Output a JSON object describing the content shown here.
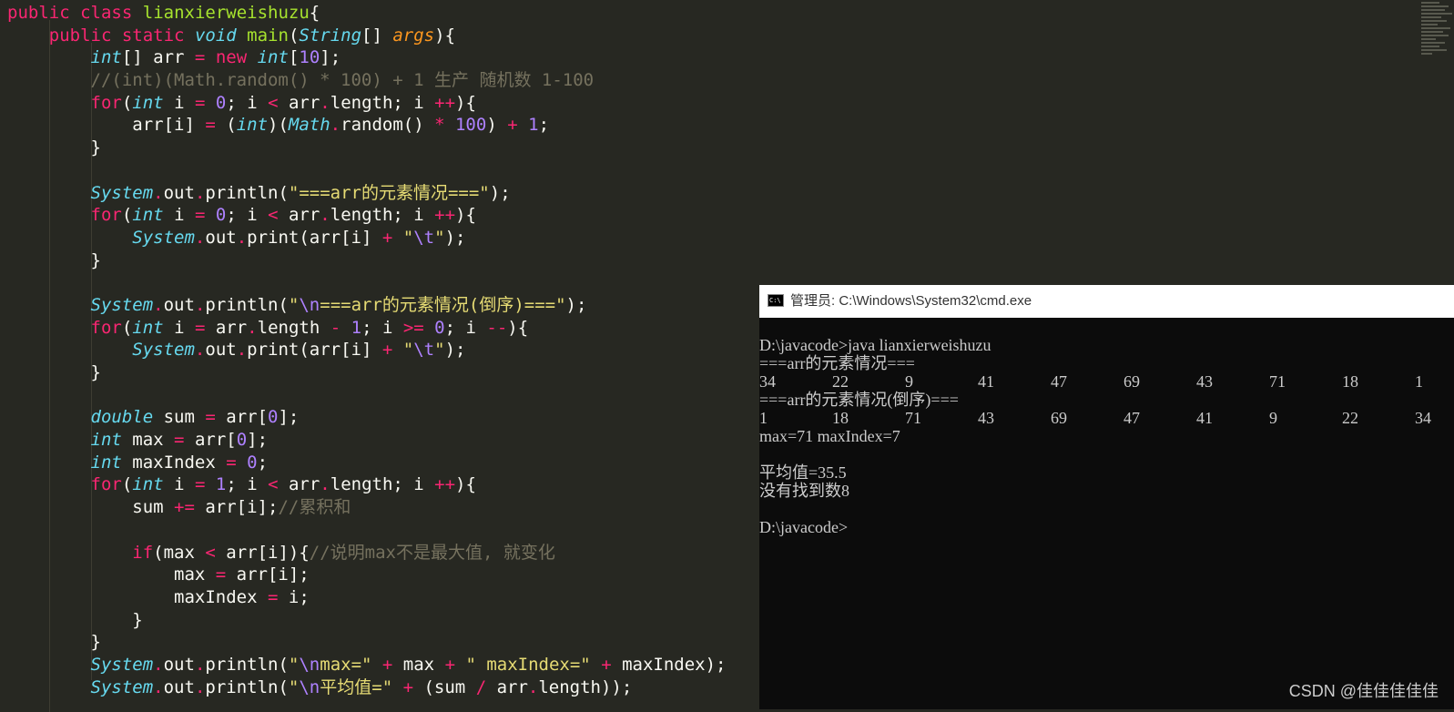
{
  "colors": {
    "editor_background": "#272822",
    "keyword": "#f92672",
    "type": "#66d9ef",
    "function": "#a6e22e",
    "string": "#e6db74",
    "number": "#ae81ff",
    "comment": "#75715e",
    "parameter": "#fd971f",
    "text": "#f8f8f2",
    "console_background": "#0c0c0c",
    "console_text": "#cccccc"
  },
  "editor": {
    "lines": [
      [
        [
          "kw",
          "public"
        ],
        [
          "tx",
          " "
        ],
        [
          "kw",
          "class"
        ],
        [
          "tx",
          " "
        ],
        [
          "fn",
          "lianxierweishuzu"
        ],
        [
          "tx",
          "{"
        ]
      ],
      [
        [
          "tx",
          "    "
        ],
        [
          "kw",
          "public"
        ],
        [
          "tx",
          " "
        ],
        [
          "kw",
          "static"
        ],
        [
          "tx",
          " "
        ],
        [
          "ty",
          "void"
        ],
        [
          "tx",
          " "
        ],
        [
          "fn",
          "main"
        ],
        [
          "tx",
          "("
        ],
        [
          "ty",
          "String"
        ],
        [
          "tx",
          "[] "
        ],
        [
          "pm",
          "args"
        ],
        [
          "tx",
          "){"
        ]
      ],
      [
        [
          "tx",
          "        "
        ],
        [
          "ty",
          "int"
        ],
        [
          "tx",
          "[] arr "
        ],
        [
          "kw",
          "="
        ],
        [
          "tx",
          " "
        ],
        [
          "kw",
          "new"
        ],
        [
          "tx",
          " "
        ],
        [
          "ty",
          "int"
        ],
        [
          "tx",
          "["
        ],
        [
          "nm",
          "10"
        ],
        [
          "tx",
          "];"
        ]
      ],
      [
        [
          "tx",
          "        "
        ],
        [
          "cm",
          "//(int)(Math.random() * 100) + 1 生产 随机数 1-100"
        ]
      ],
      [
        [
          "tx",
          "        "
        ],
        [
          "kw",
          "for"
        ],
        [
          "tx",
          "("
        ],
        [
          "ty",
          "int"
        ],
        [
          "tx",
          " i "
        ],
        [
          "kw",
          "="
        ],
        [
          "tx",
          " "
        ],
        [
          "nm",
          "0"
        ],
        [
          "tx",
          "; i "
        ],
        [
          "kw",
          "<"
        ],
        [
          "tx",
          " arr"
        ],
        [
          "kw",
          "."
        ],
        [
          "tx",
          "length; i "
        ],
        [
          "kw",
          "++"
        ],
        [
          "tx",
          "){"
        ]
      ],
      [
        [
          "tx",
          "            arr[i] "
        ],
        [
          "kw",
          "="
        ],
        [
          "tx",
          " ("
        ],
        [
          "ty",
          "int"
        ],
        [
          "tx",
          ")("
        ],
        [
          "ty",
          "Math"
        ],
        [
          "kw",
          "."
        ],
        [
          "tx",
          "random() "
        ],
        [
          "kw",
          "*"
        ],
        [
          "tx",
          " "
        ],
        [
          "nm",
          "100"
        ],
        [
          "tx",
          ") "
        ],
        [
          "kw",
          "+"
        ],
        [
          "tx",
          " "
        ],
        [
          "nm",
          "1"
        ],
        [
          "tx",
          ";"
        ]
      ],
      [
        [
          "tx",
          "        }"
        ]
      ],
      [
        [
          "tx",
          ""
        ]
      ],
      [
        [
          "tx",
          "        "
        ],
        [
          "ty",
          "System"
        ],
        [
          "kw",
          "."
        ],
        [
          "tx",
          "out"
        ],
        [
          "kw",
          "."
        ],
        [
          "tx",
          "println("
        ],
        [
          "st",
          "\"===arr的元素情况===\""
        ],
        [
          "tx",
          ");"
        ]
      ],
      [
        [
          "tx",
          "        "
        ],
        [
          "kw",
          "for"
        ],
        [
          "tx",
          "("
        ],
        [
          "ty",
          "int"
        ],
        [
          "tx",
          " i "
        ],
        [
          "kw",
          "="
        ],
        [
          "tx",
          " "
        ],
        [
          "nm",
          "0"
        ],
        [
          "tx",
          "; i "
        ],
        [
          "kw",
          "<"
        ],
        [
          "tx",
          " arr"
        ],
        [
          "kw",
          "."
        ],
        [
          "tx",
          "length; i "
        ],
        [
          "kw",
          "++"
        ],
        [
          "tx",
          "){"
        ]
      ],
      [
        [
          "tx",
          "            "
        ],
        [
          "ty",
          "System"
        ],
        [
          "kw",
          "."
        ],
        [
          "tx",
          "out"
        ],
        [
          "kw",
          "."
        ],
        [
          "tx",
          "print(arr[i] "
        ],
        [
          "kw",
          "+"
        ],
        [
          "tx",
          " "
        ],
        [
          "st",
          "\""
        ],
        [
          "nm",
          "\\t"
        ],
        [
          "st",
          "\""
        ],
        [
          "tx",
          ");"
        ]
      ],
      [
        [
          "tx",
          "        }"
        ]
      ],
      [
        [
          "tx",
          ""
        ]
      ],
      [
        [
          "tx",
          "        "
        ],
        [
          "ty",
          "System"
        ],
        [
          "kw",
          "."
        ],
        [
          "tx",
          "out"
        ],
        [
          "kw",
          "."
        ],
        [
          "tx",
          "println("
        ],
        [
          "st",
          "\""
        ],
        [
          "nm",
          "\\n"
        ],
        [
          "st",
          "===arr的元素情况(倒序)===\""
        ],
        [
          "tx",
          ");"
        ]
      ],
      [
        [
          "tx",
          "        "
        ],
        [
          "kw",
          "for"
        ],
        [
          "tx",
          "("
        ],
        [
          "ty",
          "int"
        ],
        [
          "tx",
          " i "
        ],
        [
          "kw",
          "="
        ],
        [
          "tx",
          " arr"
        ],
        [
          "kw",
          "."
        ],
        [
          "tx",
          "length "
        ],
        [
          "kw",
          "-"
        ],
        [
          "tx",
          " "
        ],
        [
          "nm",
          "1"
        ],
        [
          "tx",
          "; i "
        ],
        [
          "kw",
          ">="
        ],
        [
          "tx",
          " "
        ],
        [
          "nm",
          "0"
        ],
        [
          "tx",
          "; i "
        ],
        [
          "kw",
          "--"
        ],
        [
          "tx",
          "){"
        ]
      ],
      [
        [
          "tx",
          "            "
        ],
        [
          "ty",
          "System"
        ],
        [
          "kw",
          "."
        ],
        [
          "tx",
          "out"
        ],
        [
          "kw",
          "."
        ],
        [
          "tx",
          "print(arr[i] "
        ],
        [
          "kw",
          "+"
        ],
        [
          "tx",
          " "
        ],
        [
          "st",
          "\""
        ],
        [
          "nm",
          "\\t"
        ],
        [
          "st",
          "\""
        ],
        [
          "tx",
          ");"
        ]
      ],
      [
        [
          "tx",
          "        }"
        ]
      ],
      [
        [
          "tx",
          ""
        ]
      ],
      [
        [
          "tx",
          "        "
        ],
        [
          "ty",
          "double"
        ],
        [
          "tx",
          " sum "
        ],
        [
          "kw",
          "="
        ],
        [
          "tx",
          " arr["
        ],
        [
          "nm",
          "0"
        ],
        [
          "tx",
          "];"
        ]
      ],
      [
        [
          "tx",
          "        "
        ],
        [
          "ty",
          "int"
        ],
        [
          "tx",
          " max "
        ],
        [
          "kw",
          "="
        ],
        [
          "tx",
          " arr["
        ],
        [
          "nm",
          "0"
        ],
        [
          "tx",
          "];"
        ]
      ],
      [
        [
          "tx",
          "        "
        ],
        [
          "ty",
          "int"
        ],
        [
          "tx",
          " maxIndex "
        ],
        [
          "kw",
          "="
        ],
        [
          "tx",
          " "
        ],
        [
          "nm",
          "0"
        ],
        [
          "tx",
          ";"
        ]
      ],
      [
        [
          "tx",
          "        "
        ],
        [
          "kw",
          "for"
        ],
        [
          "tx",
          "("
        ],
        [
          "ty",
          "int"
        ],
        [
          "tx",
          " i "
        ],
        [
          "kw",
          "="
        ],
        [
          "tx",
          " "
        ],
        [
          "nm",
          "1"
        ],
        [
          "tx",
          "; i "
        ],
        [
          "kw",
          "<"
        ],
        [
          "tx",
          " arr"
        ],
        [
          "kw",
          "."
        ],
        [
          "tx",
          "length; i "
        ],
        [
          "kw",
          "++"
        ],
        [
          "tx",
          "){"
        ]
      ],
      [
        [
          "tx",
          "            sum "
        ],
        [
          "kw",
          "+="
        ],
        [
          "tx",
          " arr[i];"
        ],
        [
          "cm",
          "//累积和"
        ]
      ],
      [
        [
          "tx",
          ""
        ]
      ],
      [
        [
          "tx",
          "            "
        ],
        [
          "kw",
          "if"
        ],
        [
          "tx",
          "(max "
        ],
        [
          "kw",
          "<"
        ],
        [
          "tx",
          " arr[i]){"
        ],
        [
          "cm",
          "//说明max不是最大值, 就变化"
        ]
      ],
      [
        [
          "tx",
          "                max "
        ],
        [
          "kw",
          "="
        ],
        [
          "tx",
          " arr[i];"
        ]
      ],
      [
        [
          "tx",
          "                maxIndex "
        ],
        [
          "kw",
          "="
        ],
        [
          "tx",
          " i;"
        ]
      ],
      [
        [
          "tx",
          "            }"
        ]
      ],
      [
        [
          "tx",
          "        }"
        ]
      ],
      [
        [
          "tx",
          "        "
        ],
        [
          "ty",
          "System"
        ],
        [
          "kw",
          "."
        ],
        [
          "tx",
          "out"
        ],
        [
          "kw",
          "."
        ],
        [
          "tx",
          "println("
        ],
        [
          "st",
          "\""
        ],
        [
          "nm",
          "\\n"
        ],
        [
          "st",
          "max=\""
        ],
        [
          "tx",
          " "
        ],
        [
          "kw",
          "+"
        ],
        [
          "tx",
          " max "
        ],
        [
          "kw",
          "+"
        ],
        [
          "tx",
          " "
        ],
        [
          "st",
          "\" maxIndex=\""
        ],
        [
          "tx",
          " "
        ],
        [
          "kw",
          "+"
        ],
        [
          "tx",
          " maxIndex);"
        ]
      ],
      [
        [
          "tx",
          "        "
        ],
        [
          "ty",
          "System"
        ],
        [
          "kw",
          "."
        ],
        [
          "tx",
          "out"
        ],
        [
          "kw",
          "."
        ],
        [
          "tx",
          "println("
        ],
        [
          "st",
          "\""
        ],
        [
          "nm",
          "\\n"
        ],
        [
          "st",
          "平均值=\""
        ],
        [
          "tx",
          " "
        ],
        [
          "kw",
          "+"
        ],
        [
          "tx",
          " (sum "
        ],
        [
          "kw",
          "/"
        ],
        [
          "tx",
          " arr"
        ],
        [
          "kw",
          "."
        ],
        [
          "tx",
          "length));"
        ]
      ]
    ]
  },
  "cmd_window": {
    "title": "管理员: C:\\Windows\\System32\\cmd.exe",
    "icon": "console-icon",
    "lines": [
      {
        "text": "D:\\javacode>java lianxierweishuzu"
      },
      {
        "text": "===arr的元素情况==="
      },
      {
        "cells": [
          "34",
          "22",
          "9",
          "41",
          "47",
          "69",
          "43",
          "71",
          "18",
          "1"
        ]
      },
      {
        "text": "===arr的元素情况(倒序)==="
      },
      {
        "cells": [
          "1",
          "18",
          "71",
          "43",
          "69",
          "47",
          "41",
          "9",
          "22",
          "34"
        ]
      },
      {
        "text": "max=71 maxIndex=7"
      },
      {
        "text": ""
      },
      {
        "text": "平均值=35.5"
      },
      {
        "text": "没有找到数8"
      },
      {
        "text": ""
      },
      {
        "text": "D:\\javacode>"
      }
    ]
  },
  "watermark": "CSDN @佳佳佳佳佳"
}
